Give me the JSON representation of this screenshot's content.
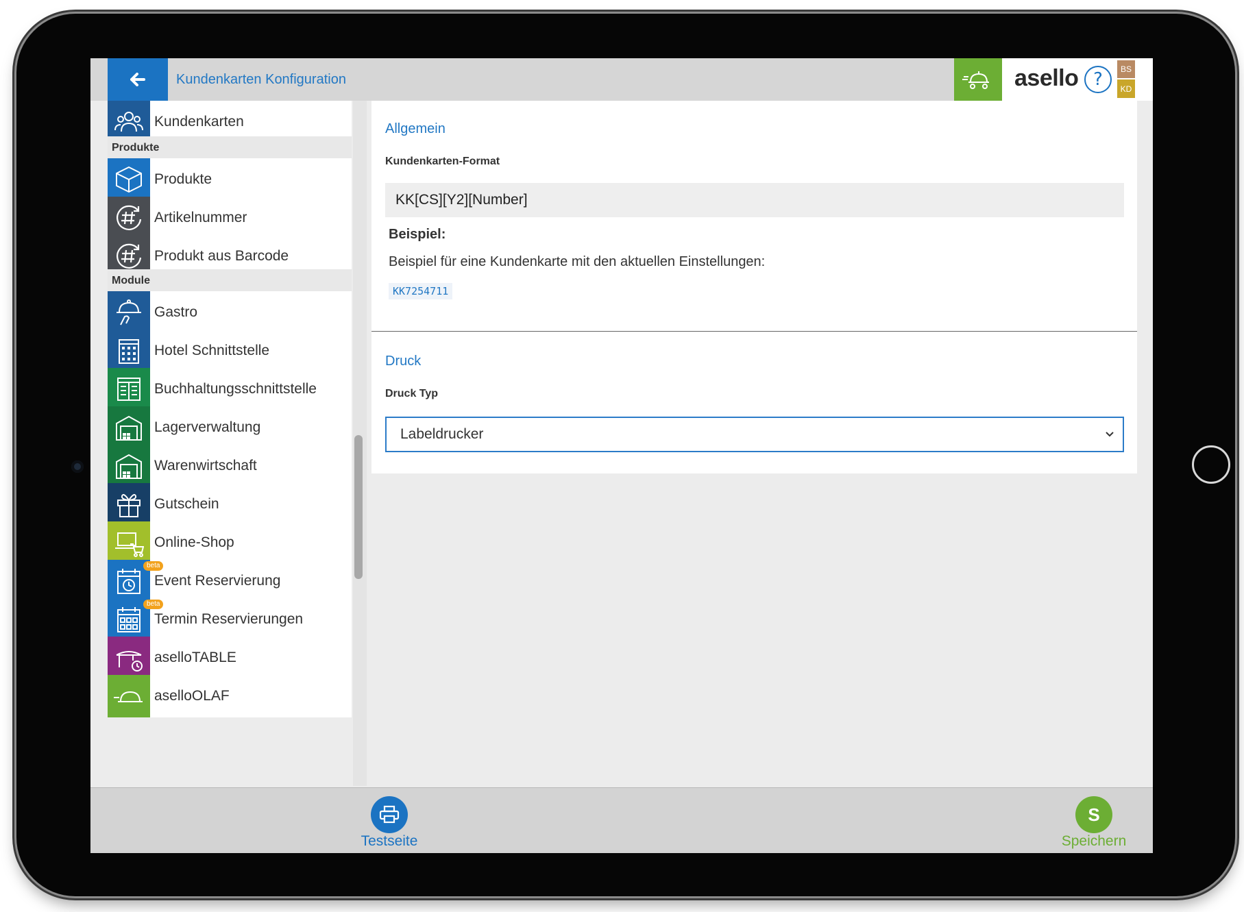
{
  "header": {
    "title": "Kundenkarten Konfiguration",
    "logo_prefix": "ase",
    "logo_suffix": "llo",
    "help_symbol": "?",
    "badge_top": "BS",
    "badge_bottom": "KD",
    "back_icon": "arrow-left-icon",
    "gastro_icon": "food-delivery-icon"
  },
  "sidebar": {
    "top_item": {
      "label": "Kundenkarten",
      "icon": "customers-icon",
      "color": "#1f5b98"
    },
    "groups": [
      {
        "title": "Produkte",
        "items": [
          {
            "label": "Produkte",
            "icon": "box-icon",
            "color": "#1b73c2"
          },
          {
            "label": "Artikelnummer",
            "icon": "hash-refresh-icon",
            "color": "#4a4d52"
          },
          {
            "label": "Produkt aus Barcode",
            "icon": "hash-refresh-icon",
            "color": "#4a4d52"
          }
        ]
      },
      {
        "title": "Module",
        "items": [
          {
            "label": "Gastro",
            "icon": "cloche-icon",
            "color": "#1f5b98"
          },
          {
            "label": "Hotel Schnittstelle",
            "icon": "building-icon",
            "color": "#1f5b98"
          },
          {
            "label": "Buchhaltungsschnittstelle",
            "icon": "ledger-icon",
            "color": "#1a8a4a"
          },
          {
            "label": "Lagerverwaltung",
            "icon": "warehouse-icon",
            "color": "#17783f"
          },
          {
            "label": "Warenwirtschaft",
            "icon": "warehouse-icon",
            "color": "#17783f"
          },
          {
            "label": "Gutschein",
            "icon": "gift-icon",
            "color": "#173f66"
          },
          {
            "label": "Online-Shop",
            "icon": "laptop-cart-icon",
            "color": "#a2bf2b"
          },
          {
            "label": "Event Reservierung",
            "icon": "calendar-clock-icon",
            "color": "#1b73c2",
            "badge": "beta"
          },
          {
            "label": "Termin Reservierungen",
            "icon": "calendar-grid-icon",
            "color": "#1b73c2",
            "badge": "beta"
          },
          {
            "label": "aselloTABLE",
            "icon": "table-clock-icon",
            "color": "#8a2a80"
          },
          {
            "label": "aselloOLAF",
            "icon": "cloche-icon",
            "color": "#6cae34"
          }
        ]
      }
    ]
  },
  "main": {
    "general": {
      "title": "Allgemein",
      "format_label": "Kundenkarten-Format",
      "format_value": "KK[CS][Y2][Number]",
      "example_heading": "Beispiel:",
      "example_text": "Beispiel für eine Kundenkarte mit den aktuellen Einstellungen:",
      "example_code": "KK7254711"
    },
    "print": {
      "title": "Druck",
      "type_label": "Druck Typ",
      "type_value": "Labeldrucker"
    }
  },
  "footer": {
    "test_label": "Testseite",
    "test_icon": "printer-icon",
    "save_label": "Speichern",
    "save_letter": "S"
  },
  "colors": {
    "primary_blue": "#1b73c2",
    "accent_green": "#6cae34"
  }
}
